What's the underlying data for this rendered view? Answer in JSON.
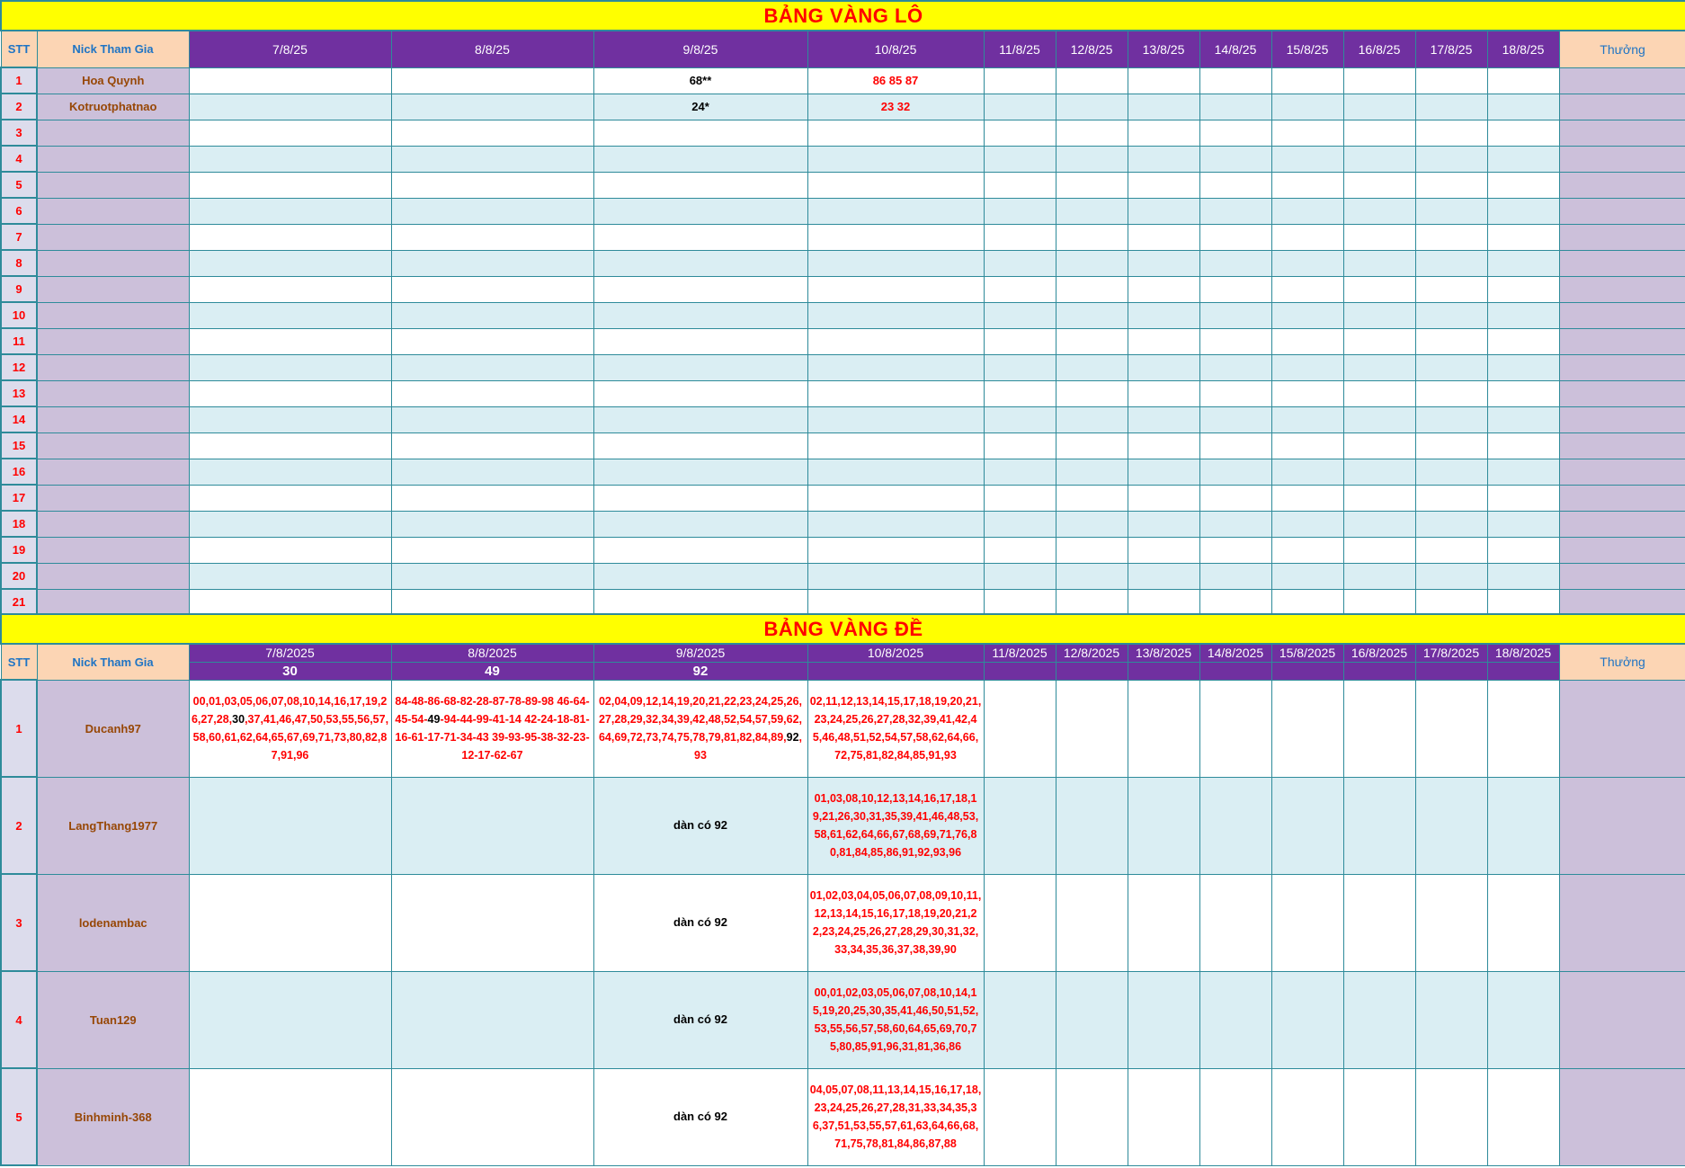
{
  "lo": {
    "title": "BẢNG VÀNG LÔ",
    "headers": {
      "stt": "STT",
      "nick": "Nick Tham Gia",
      "dates": [
        "7/8/25",
        "8/8/25",
        "9/8/25",
        "10/8/25",
        "11/8/25",
        "12/8/25",
        "13/8/25",
        "14/8/25",
        "15/8/25",
        "16/8/25",
        "17/8/25",
        "18/8/25"
      ],
      "thuong": "Thưởng"
    },
    "rows": [
      {
        "stt": "1",
        "nick": "Hoa Quynh",
        "cells": [
          "",
          "",
          "68**",
          "86 85 87",
          "",
          "",
          "",
          "",
          "",
          "",
          "",
          ""
        ]
      },
      {
        "stt": "2",
        "nick": "Kotruotphatnao",
        "cells": [
          "",
          "",
          "24*",
          "23 32",
          "",
          "",
          "",
          "",
          "",
          "",
          "",
          ""
        ]
      },
      {
        "stt": "3",
        "nick": "",
        "cells": [
          "",
          "",
          "",
          "",
          "",
          "",
          "",
          "",
          "",
          "",
          "",
          ""
        ]
      },
      {
        "stt": "4",
        "nick": "",
        "cells": [
          "",
          "",
          "",
          "",
          "",
          "",
          "",
          "",
          "",
          "",
          "",
          ""
        ]
      },
      {
        "stt": "5",
        "nick": "",
        "cells": [
          "",
          "",
          "",
          "",
          "",
          "",
          "",
          "",
          "",
          "",
          "",
          ""
        ]
      },
      {
        "stt": "6",
        "nick": "",
        "cells": [
          "",
          "",
          "",
          "",
          "",
          "",
          "",
          "",
          "",
          "",
          "",
          ""
        ]
      },
      {
        "stt": "7",
        "nick": "",
        "cells": [
          "",
          "",
          "",
          "",
          "",
          "",
          "",
          "",
          "",
          "",
          "",
          ""
        ]
      },
      {
        "stt": "8",
        "nick": "",
        "cells": [
          "",
          "",
          "",
          "",
          "",
          "",
          "",
          "",
          "",
          "",
          "",
          ""
        ]
      },
      {
        "stt": "9",
        "nick": "",
        "cells": [
          "",
          "",
          "",
          "",
          "",
          "",
          "",
          "",
          "",
          "",
          "",
          ""
        ]
      },
      {
        "stt": "10",
        "nick": "",
        "cells": [
          "",
          "",
          "",
          "",
          "",
          "",
          "",
          "",
          "",
          "",
          "",
          ""
        ]
      },
      {
        "stt": "11",
        "nick": "",
        "cells": [
          "",
          "",
          "",
          "",
          "",
          "",
          "",
          "",
          "",
          "",
          "",
          ""
        ]
      },
      {
        "stt": "12",
        "nick": "",
        "cells": [
          "",
          "",
          "",
          "",
          "",
          "",
          "",
          "",
          "",
          "",
          "",
          ""
        ]
      },
      {
        "stt": "13",
        "nick": "",
        "cells": [
          "",
          "",
          "",
          "",
          "",
          "",
          "",
          "",
          "",
          "",
          "",
          ""
        ]
      },
      {
        "stt": "14",
        "nick": "",
        "cells": [
          "",
          "",
          "",
          "",
          "",
          "",
          "",
          "",
          "",
          "",
          "",
          ""
        ]
      },
      {
        "stt": "15",
        "nick": "",
        "cells": [
          "",
          "",
          "",
          "",
          "",
          "",
          "",
          "",
          "",
          "",
          "",
          ""
        ]
      },
      {
        "stt": "16",
        "nick": "",
        "cells": [
          "",
          "",
          "",
          "",
          "",
          "",
          "",
          "",
          "",
          "",
          "",
          ""
        ]
      },
      {
        "stt": "17",
        "nick": "",
        "cells": [
          "",
          "",
          "",
          "",
          "",
          "",
          "",
          "",
          "",
          "",
          "",
          ""
        ]
      },
      {
        "stt": "18",
        "nick": "",
        "cells": [
          "",
          "",
          "",
          "",
          "",
          "",
          "",
          "",
          "",
          "",
          "",
          ""
        ]
      },
      {
        "stt": "19",
        "nick": "",
        "cells": [
          "",
          "",
          "",
          "",
          "",
          "",
          "",
          "",
          "",
          "",
          "",
          ""
        ]
      },
      {
        "stt": "20",
        "nick": "",
        "cells": [
          "",
          "",
          "",
          "",
          "",
          "",
          "",
          "",
          "",
          "",
          "",
          ""
        ]
      },
      {
        "stt": "21",
        "nick": "",
        "cells": [
          "",
          "",
          "",
          "",
          "",
          "",
          "",
          "",
          "",
          "",
          "",
          ""
        ]
      }
    ]
  },
  "de": {
    "title": "BẢNG VÀNG ĐỀ",
    "headers": {
      "stt": "STT",
      "nick": "Nick Tham Gia",
      "dates": [
        "7/8/2025",
        "8/8/2025",
        "9/8/2025",
        "10/8/2025",
        "11/8/2025",
        "12/8/2025",
        "13/8/2025",
        "14/8/2025",
        "15/8/2025",
        "16/8/2025",
        "17/8/2025",
        "18/8/2025"
      ],
      "results": [
        "30",
        "49",
        "92",
        "",
        "",
        "",
        "",
        "",
        "",
        "",
        "",
        ""
      ],
      "thuong": "Thưởng"
    },
    "rows": [
      {
        "stt": "1",
        "nick": "Ducanh97",
        "cells": [
          "00,01,03,05,06,07,08,10,14,16,17,19,26,27,28,30,37,41,46,47,50,53,55,56,57,58,60,61,62,64,65,67,69,71,73,80,82,87,91,96",
          "84-48-86-68-82-28-87-78-89-98 46-64-45-54-49-94-44-99-41-14 42-24-18-81-16-61-17-71-34-43 39-93-95-38-32-23-12-17-62-67",
          "02,04,09,12,14,19,20,21,22,23,24,25,26,27,28,29,32,34,39,42,48,52,54,57,59,62,64,69,72,73,74,75,78,79,81,82,84,89,92,93",
          "02,11,12,13,14,15,17,18,19,20,21,23,24,25,26,27,28,32,39,41,42,45,46,48,51,52,54,57,58,62,64,66,72,75,81,82,84,85,91,93",
          "",
          "",
          "",
          "",
          "",
          "",
          "",
          ""
        ]
      },
      {
        "stt": "2",
        "nick": "LangThang1977",
        "cells": [
          "",
          "",
          "dàn có 92",
          "01,03,08,10,12,13,14,16,17,18,19,21,26,30,31,35,39,41,46,48,53,58,61,62,64,66,67,68,69,71,76,80,81,84,85,86,91,92,93,96",
          "",
          "",
          "",
          "",
          "",
          "",
          "",
          ""
        ]
      },
      {
        "stt": "3",
        "nick": "lodenambac",
        "cells": [
          "",
          "",
          "dàn có 92",
          "01,02,03,04,05,06,07,08,09,10,11,12,13,14,15,16,17,18,19,20,21,22,23,24,25,26,27,28,29,30,31,32,33,34,35,36,37,38,39,90",
          "",
          "",
          "",
          "",
          "",
          "",
          "",
          ""
        ]
      },
      {
        "stt": "4",
        "nick": "Tuan129",
        "cells": [
          "",
          "",
          "dàn có 92",
          "00,01,02,03,05,06,07,08,10,14,15,19,20,25,30,35,41,46,50,51,52,53,55,56,57,58,60,64,65,69,70,75,80,85,91,96,31,81,36,86",
          "",
          "",
          "",
          "",
          "",
          "",
          "",
          ""
        ]
      },
      {
        "stt": "5",
        "nick": "Binhminh-368",
        "cells": [
          "",
          "",
          "dàn có 92",
          "04,05,07,08,11,13,14,15,16,17,18,23,24,25,26,27,28,31,33,34,35,36,37,51,53,55,57,61,63,64,66,68,71,75,78,81,84,86,87,88",
          "",
          "",
          "",
          "",
          "",
          "",
          "",
          ""
        ]
      }
    ]
  },
  "colors": {
    "title_bg": "#ffff00",
    "title_text": "#ff0000",
    "header_purple": "#7030a0",
    "header_peach": "#fcd5b4",
    "header_blue_text": "#1f74c4",
    "nick_bg": "#ccc0da",
    "nick_text": "#974706",
    "row_alt": "#daeef3",
    "grid": "#2e8b9a"
  }
}
